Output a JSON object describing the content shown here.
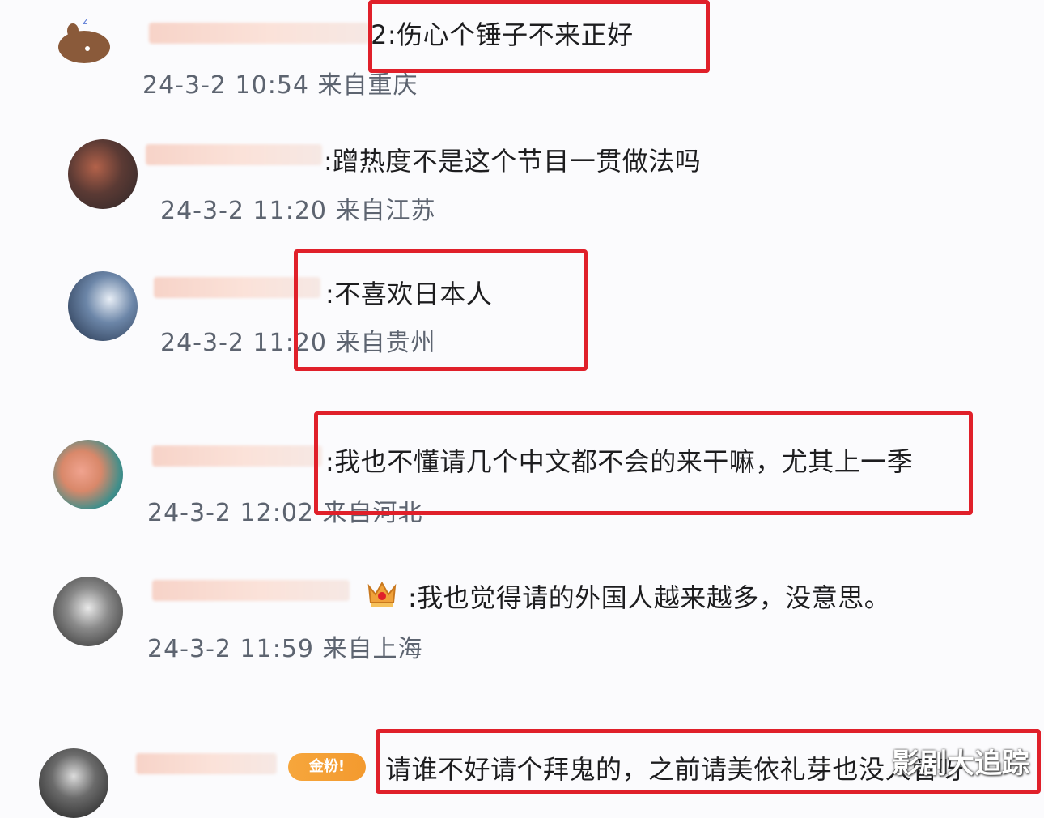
{
  "comments": [
    {
      "text": "2:伤心个锤子不来正好",
      "meta": "24-3-2 10:54 来自重庆"
    },
    {
      "text": ":蹭热度不是这个节目一贯做法吗",
      "meta": "24-3-2 11:20 来自江苏"
    },
    {
      "text": ":不喜欢日本人",
      "meta": "24-3-2 11:20 来自贵州"
    },
    {
      "text": ":我也不懂请几个中文都不会的来干嘛，尤其上一季",
      "meta": "24-3-2 12:02 来自河北"
    },
    {
      "text": ":我也觉得请的外国人越来越多，没意思。",
      "meta": "24-3-2 11:59 来自上海"
    },
    {
      "text": "请谁不好请个拜鬼的，之前请美依礼芽也没人管呀",
      "meta": ""
    }
  ],
  "badges": {
    "gold_pill": "金粉!"
  },
  "watermark": "影剧大追踪",
  "colors": {
    "highlight": "#e0202a",
    "meta": "#5d6470",
    "text": "#1d1d1f"
  }
}
